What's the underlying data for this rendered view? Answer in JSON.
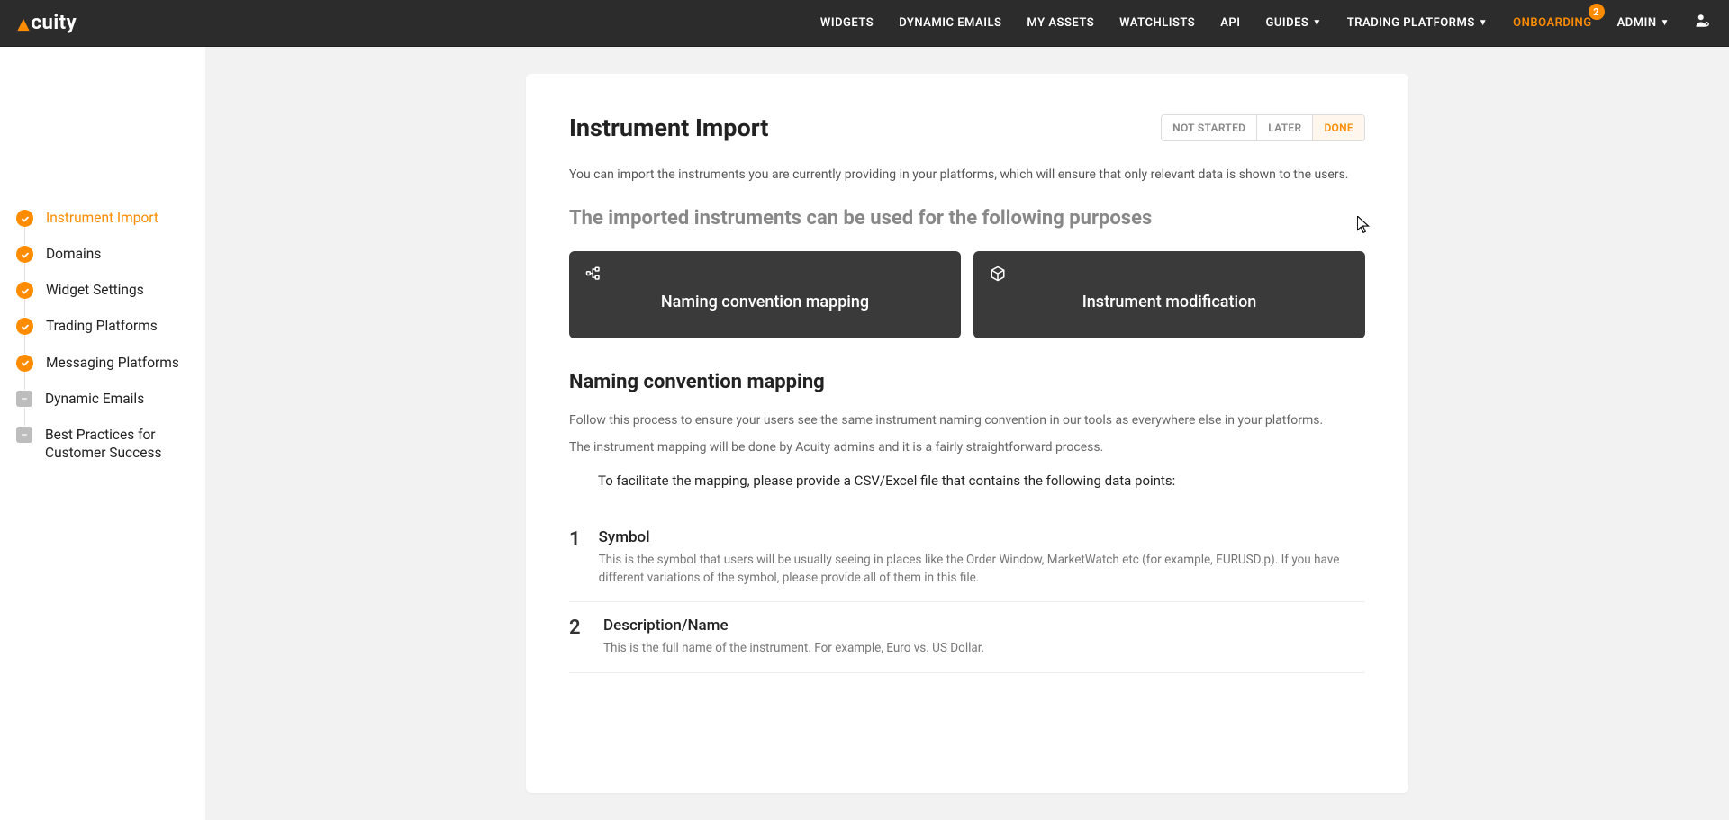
{
  "brand": {
    "name": "cuity"
  },
  "nav": {
    "items": [
      {
        "label": "WIDGETS",
        "dropdown": false
      },
      {
        "label": "DYNAMIC EMAILS",
        "dropdown": false
      },
      {
        "label": "MY ASSETS",
        "dropdown": false
      },
      {
        "label": "WATCHLISTS",
        "dropdown": false
      },
      {
        "label": "API",
        "dropdown": false
      },
      {
        "label": "GUIDES",
        "dropdown": true
      },
      {
        "label": "TRADING PLATFORMS",
        "dropdown": true
      },
      {
        "label": "ONBOARDING",
        "dropdown": false,
        "active": true,
        "badge": "2"
      },
      {
        "label": "ADMIN",
        "dropdown": true
      }
    ]
  },
  "sidebar": {
    "items": [
      {
        "label": "Instrument Import",
        "status": "done",
        "active": true
      },
      {
        "label": "Domains",
        "status": "done"
      },
      {
        "label": "Widget Settings",
        "status": "done"
      },
      {
        "label": "Trading Platforms",
        "status": "done"
      },
      {
        "label": "Messaging Platforms",
        "status": "done"
      },
      {
        "label": "Dynamic Emails",
        "status": "pending"
      },
      {
        "label": "Best Practices for Customer Success",
        "status": "pending"
      }
    ]
  },
  "page": {
    "title": "Instrument Import",
    "status_options": {
      "not_started": "NOT STARTED",
      "later": "LATER",
      "done": "DONE"
    },
    "intro": "You can import the instruments you are currently providing in your platforms, which will ensure that only relevant data is shown to the users.",
    "purposes_heading": "The imported instruments can be used for the following purposes",
    "tiles": {
      "naming": "Naming convention mapping",
      "modification": "Instrument modification"
    },
    "section": {
      "title": "Naming convention mapping",
      "p1": "Follow this process to ensure your users see the same instrument naming convention in our tools as everywhere else in your platforms.",
      "p2": "The instrument mapping will be done by Acuity admins and it is a fairly straightforward process.",
      "csv_note": "To facilitate the mapping, please provide a CSV/Excel file that contains the following data points:",
      "dp1": {
        "num": "1",
        "title": "Symbol",
        "desc": "This is the symbol that users will be usually seeing in places like the Order Window, MarketWatch etc (for example, EURUSD.p). If you have different variations of the symbol, please provide all of them in this file."
      },
      "dp2": {
        "num": "2",
        "title": "Description/Name",
        "desc": "This is the full name of the instrument. For example, Euro vs. US Dollar."
      }
    }
  }
}
